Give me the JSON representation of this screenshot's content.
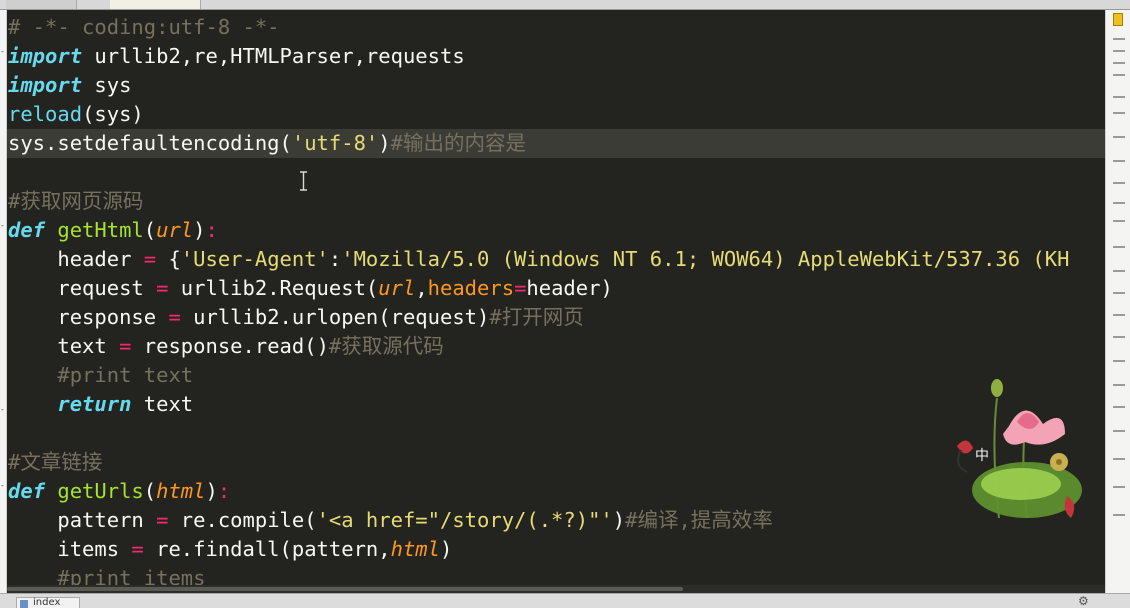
{
  "tabs": [
    {
      "label": ""
    },
    {
      "label": ""
    }
  ],
  "code_lines": [
    "# -*- coding:utf-8 -*-",
    "import urllib2,re,HTMLParser,requests",
    "import sys",
    "reload(sys)",
    "sys.setdefaultencoding('utf-8')#输出的内容是",
    "",
    "#获取网页源码",
    "def getHtml(url):",
    "    header = {'User-Agent':'Mozilla/5.0 (Windows NT 6.1; WOW64) AppleWebKit/537.36 (KH",
    "    request = urllib2.Request(url,headers=header)",
    "    response = urllib2.urlopen(request)#打开网页",
    "    text = response.read()#获取源代码",
    "    #print text",
    "    return text",
    "",
    "#文章链接",
    "def getUrls(html):",
    "    pattern = re.compile('<a href=\"/story/(.*?)\"')#编译,提高效率",
    "    items = re.findall(pattern,html)",
    "    #print items"
  ],
  "status": {
    "tab_label": "index"
  },
  "colors": {
    "background": "#23241f",
    "keyword": "#66d9ef",
    "function": "#a6e22e",
    "string": "#e6db74",
    "comment": "#75715e",
    "argument": "#fd971f"
  },
  "icons": {
    "gear": "gear-icon",
    "lotus": "lotus-decoration"
  }
}
